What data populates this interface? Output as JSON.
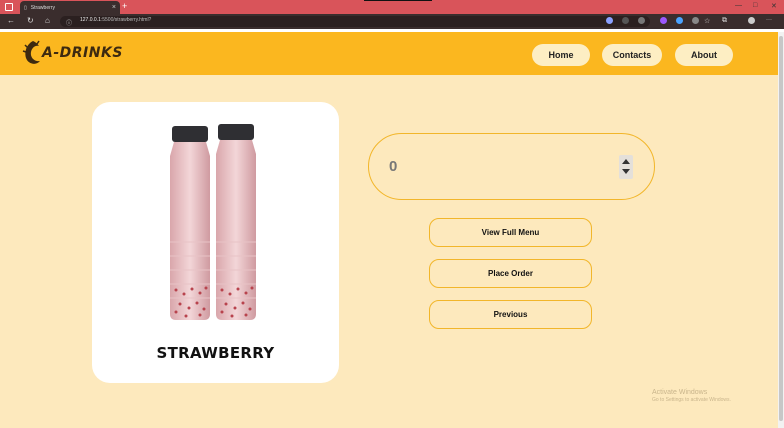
{
  "browser": {
    "tab_title": "Strawberry",
    "url_host": "127.0.0.1",
    "url_path": ":5500/strawberry.html?",
    "new_tab": "+",
    "tab_close": "×",
    "win_min": "—",
    "win_max": "□",
    "win_close": "✕",
    "more": "···"
  },
  "navbar": {
    "logo_text": "A-DRINKS",
    "links": [
      "Home",
      "Contacts",
      "About"
    ]
  },
  "product": {
    "name": "STRAWBERRY"
  },
  "quantity": {
    "value": "0"
  },
  "actions": [
    "View Full Menu",
    "Place Order",
    "Previous"
  ],
  "watermark": {
    "line1": "Activate Windows",
    "line2": "Go to Settings to activate Windows."
  },
  "colors": {
    "navbar": "#fbb71f",
    "page_bg": "#fde9bd",
    "accent_border": "#f2b62a"
  }
}
